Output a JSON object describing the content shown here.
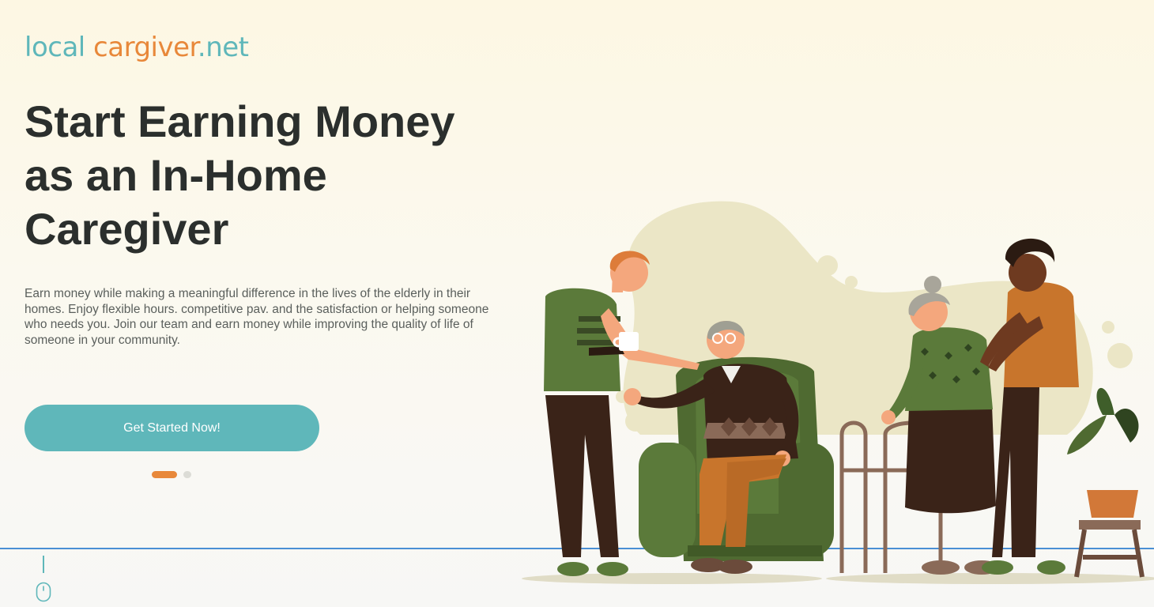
{
  "brand": {
    "part1": "local",
    "part2": "cargiver",
    "part3": ".net"
  },
  "hero": {
    "headline": "Start Earning Money as an In-Home Caregiver",
    "description": "Earn money while making a meaningful difference in the lives of the elderly in their homes. Enjoy flexible hours. competitive pav. and the satisfaction or helping someone who needs you. Join our team and earn money while improving the quality of life of someone in your community.",
    "cta_label": "Get Started Now!",
    "carousel": {
      "slides": 2,
      "active": 1
    }
  },
  "icons": {
    "scroll": "mouse-scroll-icon"
  },
  "colors": {
    "teal": "#5fb7ba",
    "orange": "#e8883a",
    "heading": "#2b2f2d",
    "body_text": "#5a5f5c",
    "divider": "#4a8fd4"
  }
}
